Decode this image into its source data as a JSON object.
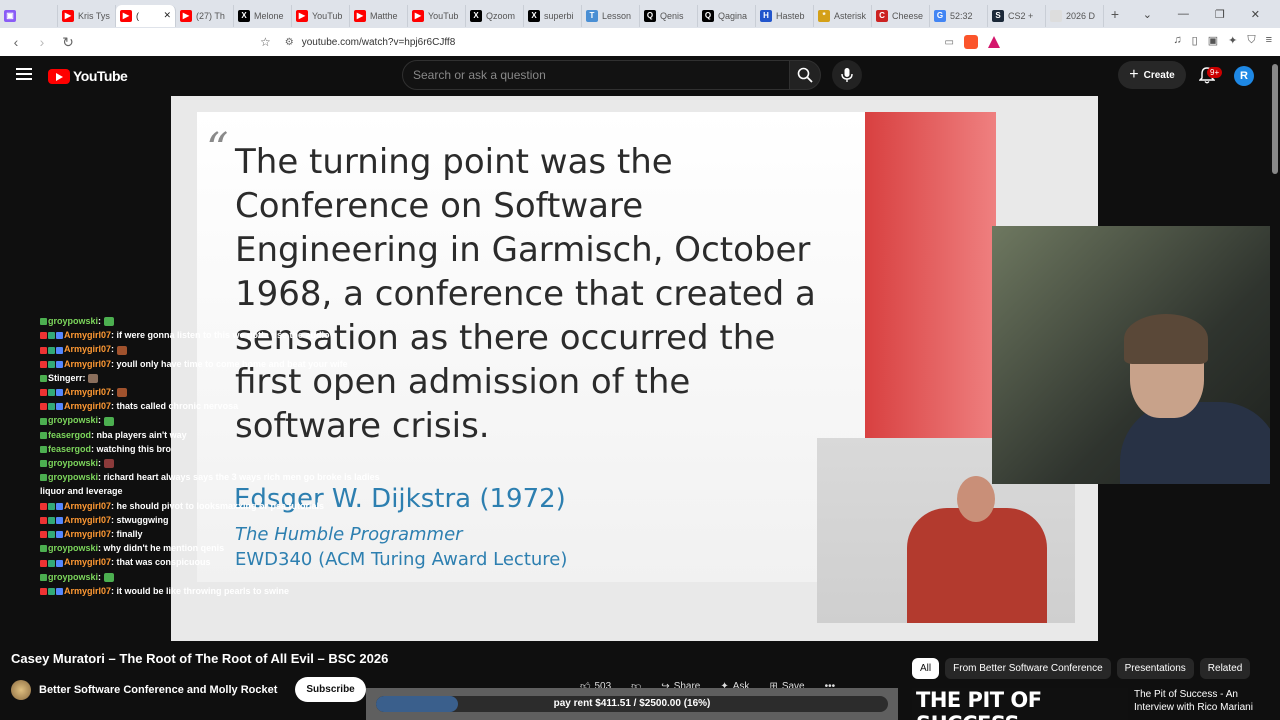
{
  "browser": {
    "tabs": [
      {
        "label": "",
        "color": "#8a5cf6",
        "letter": "▣"
      },
      {
        "label": "Kris Tys",
        "color": "#ff0000",
        "letter": "▶"
      },
      {
        "label": "(",
        "color": "#ff0000",
        "letter": "▶",
        "active": true
      },
      {
        "label": "(27) Th",
        "color": "#ff0000",
        "letter": "▶"
      },
      {
        "label": "Melone",
        "color": "#000000",
        "letter": "X"
      },
      {
        "label": "YouTub",
        "color": "#ff0000",
        "letter": "▶"
      },
      {
        "label": "Matthe",
        "color": "#ff0000",
        "letter": "▶"
      },
      {
        "label": "YouTub",
        "color": "#ff0000",
        "letter": "▶"
      },
      {
        "label": "Qzoom",
        "color": "#000000",
        "letter": "X"
      },
      {
        "label": "superbi",
        "color": "#000000",
        "letter": "X"
      },
      {
        "label": "Lesson",
        "color": "#4a8fd4",
        "letter": "T"
      },
      {
        "label": "Qenis",
        "color": "#000000",
        "letter": "Q"
      },
      {
        "label": "Qagina",
        "color": "#000000",
        "letter": "Q"
      },
      {
        "label": "Hasteb",
        "color": "#2255cc",
        "letter": "H"
      },
      {
        "label": "Asterisk",
        "color": "#d4a017",
        "letter": "*"
      },
      {
        "label": "Cheese",
        "color": "#cc2222",
        "letter": "C"
      },
      {
        "label": "52:32",
        "color": "#4285f4",
        "letter": "G"
      },
      {
        "label": "CS2 +",
        "color": "#1b2838",
        "letter": "S"
      },
      {
        "label": "2026 D",
        "color": "#dddddd",
        "letter": ""
      }
    ],
    "url": "youtube.com/watch?v=hpj6r6CJff8"
  },
  "youtube": {
    "logo_text": "YouTube",
    "search_placeholder": "Search or ask a question",
    "create_label": "Create",
    "notification_count": "9+",
    "avatar_letter": "R"
  },
  "slide": {
    "quote": "The turning point was the Conference on Software Engineering in Garmisch, October 1968, a conference that created a sensation as there occurred the first open admission of the software crisis.",
    "author": "Edsger W. Dijkstra (1972)",
    "book": "The Humble Programmer",
    "lecture": "EWD340 (ACM Turing Award Lecture)"
  },
  "chat": [
    {
      "user": "groypowski",
      "user_color": "#7cd65c",
      "msg": "",
      "emote": "#4caf50"
    },
    {
      "user": "Armygirl07",
      "user_color": "#ff9933",
      "msg": "if were gonna listen to this we gotta use the audio",
      "emote": ""
    },
    {
      "user": "Armygirl07",
      "user_color": "#ff9933",
      "msg": "",
      "emote": "#a0522d"
    },
    {
      "user": "Armygirl07",
      "user_color": "#ff9933",
      "msg": "youll only have time to come home and beat your wife",
      "emote": ""
    },
    {
      "user": "Stingerr",
      "user_color": "#ffffff",
      "msg": "",
      "emote": "#8b6f5c"
    },
    {
      "user": "Armygirl07",
      "user_color": "#ff9933",
      "msg": "",
      "emote": "#a0522d"
    },
    {
      "user": "Armygirl07",
      "user_color": "#ff9933",
      "msg": "thats called chronic nervosa",
      "emote": ""
    },
    {
      "user": "groypowski",
      "user_color": "#7cd65c",
      "msg": "",
      "emote": "#4caf50"
    },
    {
      "user": "feasergod",
      "user_color": "#7cd65c",
      "msg": "nba players ain't way",
      "emote": ""
    },
    {
      "user": "feasergod",
      "user_color": "#7cd65c",
      "msg": "watching this bro",
      "emote": ""
    },
    {
      "user": "groypowski",
      "user_color": "#7cd65c",
      "msg": "",
      "emote": "#8b3a3a"
    },
    {
      "user": "groypowski",
      "user_color": "#7cd65c",
      "msg": "richard heart always says the 3 ways rich men go broke is ladies",
      "emote": ""
    },
    {
      "user": "",
      "user_color": "#ffffff",
      "msg": "liquor and leverage",
      "emote": ""
    },
    {
      "user": "Armygirl07",
      "user_color": "#ff9933",
      "msg": "he should pivot to looksmaxxing or psa tutorials",
      "emote": ""
    },
    {
      "user": "Armygirl07",
      "user_color": "#ff9933",
      "msg": "stwuggwing",
      "emote": ""
    },
    {
      "user": "Armygirl07",
      "user_color": "#ff9933",
      "msg": "finally",
      "emote": ""
    },
    {
      "user": "groypowski",
      "user_color": "#7cd65c",
      "msg": "why didn't he mention qenis",
      "emote": ""
    },
    {
      "user": "Armygirl07",
      "user_color": "#ff9933",
      "msg": "that was conspicuous",
      "emote": ""
    },
    {
      "user": "groypowski",
      "user_color": "#7cd65c",
      "msg": "",
      "emote": "#4caf50"
    },
    {
      "user": "Armygirl07",
      "user_color": "#ff9933",
      "msg": "it would be like throwing pearls to swine",
      "emote": ""
    }
  ],
  "video": {
    "title": "Casey Muratori – The Root of The Root of All Evil – BSC 2026",
    "channel": "Better Software Conference and Molly Rocket",
    "subscribe_label": "Subscribe",
    "likes": "503",
    "share_label": "Share",
    "ask_label": "Ask",
    "save_label": "Save"
  },
  "rent": {
    "text": "pay rent $411.51 / $2500.00 (16%)",
    "progress": 0.16
  },
  "sidebar": {
    "chips": [
      "All",
      "From Better Software Conference",
      "Presentations",
      "Related"
    ],
    "related_thumb_text": "THE PIT OF SUCCESS",
    "related_title": "The Pit of Success - An Interview with Rico Mariani"
  }
}
